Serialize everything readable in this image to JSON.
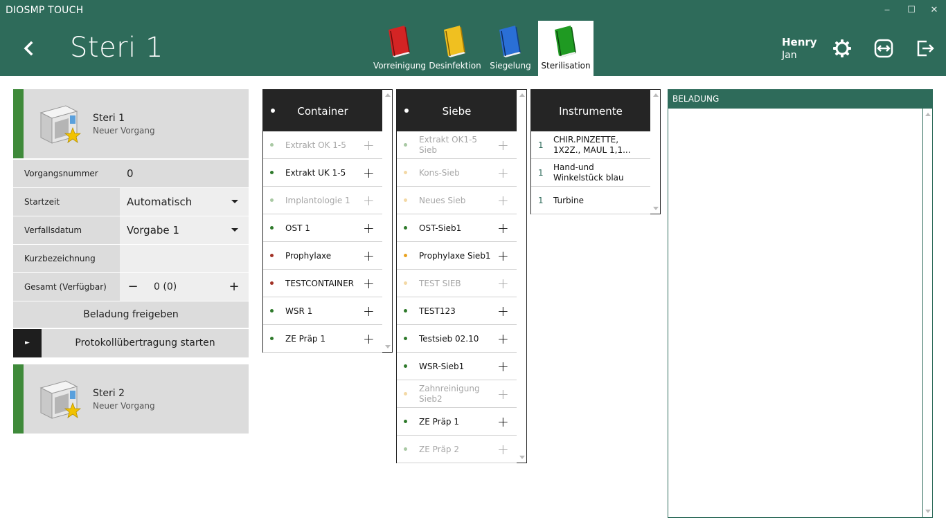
{
  "window": {
    "app_title": "DIOSMP TOUCH",
    "minimize": "‒",
    "maximize": "☐",
    "close": "✕"
  },
  "header": {
    "page_title": "Steri 1",
    "tabs": [
      {
        "label": "Vorreinigung",
        "color": "#d42424",
        "active": false
      },
      {
        "label": "Desinfektion",
        "color": "#f0c020",
        "active": false
      },
      {
        "label": "Siegelung",
        "color": "#2a6fd6",
        "active": false
      },
      {
        "label": "Sterilisation",
        "color": "#1f9a22",
        "active": true
      }
    ],
    "user": {
      "first_line": "Henry",
      "second_line": "Jan"
    },
    "icons": [
      "gear-icon",
      "sync-icon",
      "logout-icon"
    ]
  },
  "sterilizers": [
    {
      "name": "Steri 1",
      "subtitle": "Neuer Vorgang",
      "form": {
        "vorgangsnummer": {
          "label": "Vorgangsnummer",
          "value": "0"
        },
        "startzeit": {
          "label": "Startzeit",
          "value": "Automatisch"
        },
        "verfallsdatum": {
          "label": "Verfallsdatum",
          "value": "Vorgabe 1"
        },
        "kurzbezeichnung": {
          "label": "Kurzbezeichnung",
          "value": ""
        },
        "gesamt": {
          "label": "Gesamt (Verfügbar)",
          "value": "0 (0)",
          "minus": "−",
          "plus": "+"
        }
      },
      "release_label": "Beladung freigeben",
      "protocol_label": "Protokollübertragung starten",
      "play_symbol": "►"
    },
    {
      "name": "Steri 2",
      "subtitle": "Neuer Vorgang"
    }
  ],
  "containers": {
    "title": "Container",
    "items": [
      {
        "label": "Extrakt OK 1-5",
        "dot": "#a9c9a4",
        "state": "dim"
      },
      {
        "label": "Extrakt UK 1-5",
        "dot": "#2f7a2c",
        "state": "full"
      },
      {
        "label": "Implantologie 1",
        "dot": "#a9c9a4",
        "state": "dim"
      },
      {
        "label": "OST 1",
        "dot": "#2f7a2c",
        "state": "full"
      },
      {
        "label": "Prophylaxe",
        "dot": "#a23226",
        "state": "full"
      },
      {
        "label": "TESTCONTAINER",
        "dot": "#a23226",
        "state": "full"
      },
      {
        "label": "WSR 1",
        "dot": "#2f7a2c",
        "state": "full"
      },
      {
        "label": "ZE Präp 1",
        "dot": "#2f7a2c",
        "state": "full"
      }
    ]
  },
  "siebe": {
    "title": "Siebe",
    "items": [
      {
        "label": "Extrakt OK1-5 Sieb",
        "dot": "#a9c9a4",
        "state": "dim"
      },
      {
        "label": "Kons-Sieb",
        "dot": "#f3d9a6",
        "state": "dim"
      },
      {
        "label": "Neues Sieb",
        "dot": "#f3d9a6",
        "state": "dim"
      },
      {
        "label": "OST-Sieb1",
        "dot": "#2f7a2c",
        "state": "full"
      },
      {
        "label": "Prophylaxe Sieb1",
        "dot": "#e9a322",
        "state": "full"
      },
      {
        "label": "TEST SIEB",
        "dot": "#f3d9a6",
        "state": "dim"
      },
      {
        "label": "TEST123",
        "dot": "#2f7a2c",
        "state": "full"
      },
      {
        "label": "Testsieb 02.10",
        "dot": "#2f7a2c",
        "state": "full"
      },
      {
        "label": "WSR-Sieb1",
        "dot": "#2f7a2c",
        "state": "full"
      },
      {
        "label": "Zahnreinigung Sieb2",
        "dot": "#f3d9a6",
        "state": "dim"
      },
      {
        "label": "ZE Präp 1",
        "dot": "#2f7a2c",
        "state": "full"
      },
      {
        "label": "ZE Präp 2",
        "dot": "#a9c9a4",
        "state": "dim"
      }
    ]
  },
  "instrumente": {
    "title": "Instrumente",
    "items": [
      {
        "count": "1",
        "label": "CHIR.PINZETTE, 1X2Z., MAUL 1,1..."
      },
      {
        "count": "1",
        "label": "Hand-und Winkelstück blau"
      },
      {
        "count": "1",
        "label": "Turbine"
      }
    ]
  },
  "beladung": {
    "title": "BELADUNG"
  },
  "colors": {
    "brand": "#2e6b5a",
    "accent_green": "#3f8a3a",
    "column_header": "#252525"
  }
}
